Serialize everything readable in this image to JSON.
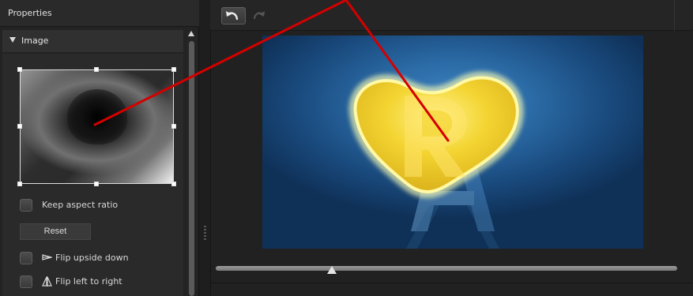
{
  "properties": {
    "title": "Properties",
    "section_label": "Image"
  },
  "controls": {
    "keep_aspect_ratio": {
      "label": "Keep aspect ratio",
      "checked": false
    },
    "reset_label": "Reset",
    "flip_upside_down": {
      "label": "Flip upside down",
      "checked": false,
      "icon": "flip-vertical-icon"
    },
    "flip_left_to_right": {
      "label": "Flip left to right",
      "checked": false,
      "icon": "flip-horizontal-icon"
    }
  },
  "toolbar": {
    "undo_icon": "undo-icon",
    "redo_icon": "redo-icon"
  },
  "preview": {
    "playback_position": 0.24,
    "background_icon": "letter-a-logo",
    "foreground_icon": "glowing-heart-r-mask"
  },
  "colors": {
    "annotation": "#d40000",
    "preview_blue": "#1d5c99",
    "heart_yellow": "#f1d53a"
  }
}
